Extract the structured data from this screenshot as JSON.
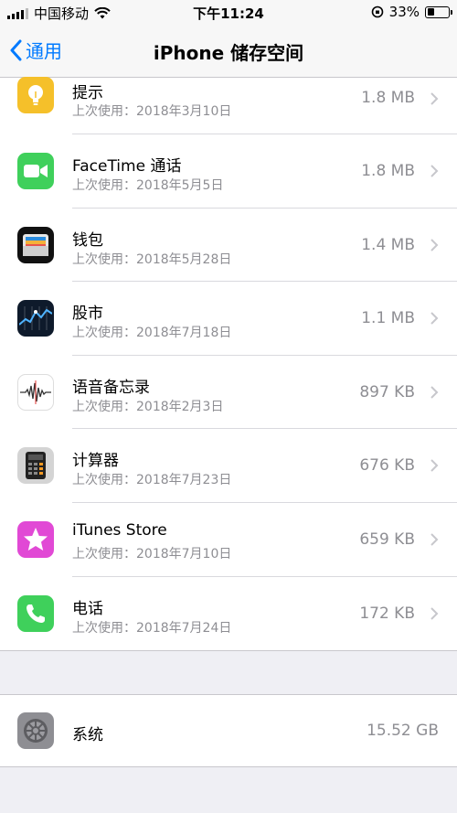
{
  "status_bar": {
    "carrier": "中国移动",
    "time": "下午11:24",
    "battery": "33%",
    "battery_level": 0.33
  },
  "nav": {
    "back_label": "通用",
    "title": "iPhone 储存空间"
  },
  "apps": [
    {
      "name": "提示",
      "last_used": "上次使用：2018年3月10日",
      "size": "1.8 MB",
      "icon": "tips-icon",
      "color": "#f5c02a"
    },
    {
      "name": "FaceTime 通话",
      "last_used": "上次使用：2018年5月5日",
      "size": "1.8 MB",
      "icon": "facetime-icon",
      "color": "#3fd05b"
    },
    {
      "name": "钱包",
      "last_used": "上次使用：2018年5月28日",
      "size": "1.4 MB",
      "icon": "wallet-icon",
      "color": "#111111"
    },
    {
      "name": "股市",
      "last_used": "上次使用：2018年7月18日",
      "size": "1.1 MB",
      "icon": "stocks-icon",
      "color": "#0e1a2b"
    },
    {
      "name": "语音备忘录",
      "last_used": "上次使用：2018年2月3日",
      "size": "897 KB",
      "icon": "voice-memos-icon",
      "color": "#ffffff"
    },
    {
      "name": "计算器",
      "last_used": "上次使用：2018年7月23日",
      "size": "676 KB",
      "icon": "calculator-icon",
      "color": "#d4d4d4"
    },
    {
      "name": "iTunes Store",
      "last_used": "上次使用：2018年7月10日",
      "size": "659 KB",
      "icon": "itunes-store-icon",
      "color": "#e149d5"
    },
    {
      "name": "电话",
      "last_used": "上次使用：2018年7月24日",
      "size": "172 KB",
      "icon": "phone-icon",
      "color": "#3fd05b"
    }
  ],
  "system": {
    "name": "系统",
    "size": "15.52 GB",
    "icon": "settings-gear-icon"
  }
}
